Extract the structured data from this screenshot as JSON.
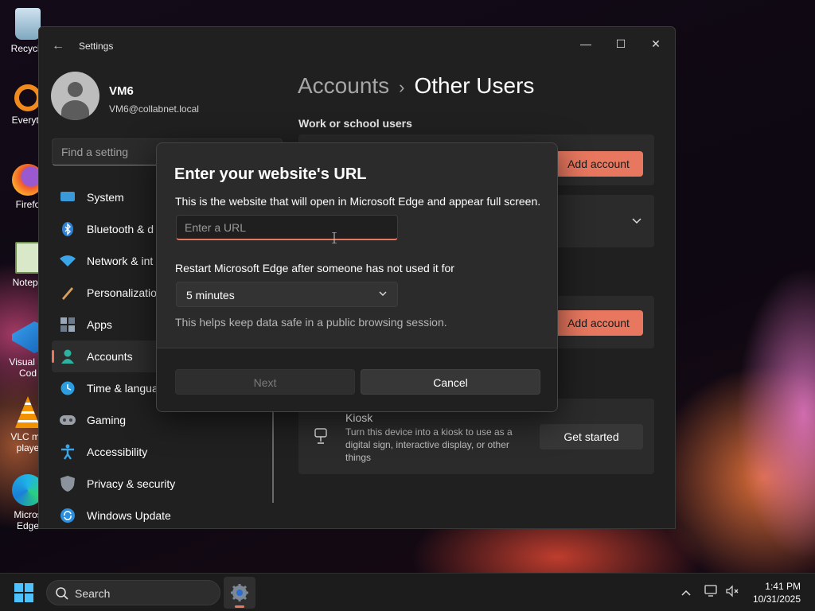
{
  "colors": {
    "accent": "#e8775f",
    "window_bg": "#202020",
    "card_bg": "#2b2b2b",
    "taskbar_bg": "#1c1c1c"
  },
  "desktop": {
    "icons": [
      {
        "label": "Recycle",
        "icon": "recycle-bin-icon"
      },
      {
        "label": "Everyth",
        "icon": "everything-search-icon"
      },
      {
        "label": "Firefo",
        "icon": "firefox-icon"
      },
      {
        "label": "Notepa",
        "icon": "notepad-icon"
      },
      {
        "label": "Visual St Cod",
        "icon": "vscode-icon"
      },
      {
        "label": "VLC me playe",
        "icon": "vlc-icon"
      },
      {
        "label": "Micros Edge",
        "icon": "edge-icon"
      }
    ]
  },
  "window": {
    "title": "Settings",
    "controls": {
      "minimize": "—",
      "maximize": "☐",
      "close": "✕"
    }
  },
  "profile": {
    "name": "VM6",
    "email": "VM6@collabnet.local"
  },
  "search": {
    "placeholder": "Find a setting"
  },
  "nav": {
    "items": [
      {
        "label": "System",
        "icon": "system-icon"
      },
      {
        "label": "Bluetooth & d",
        "icon": "bluetooth-icon"
      },
      {
        "label": "Network & int",
        "icon": "network-icon"
      },
      {
        "label": "Personalization",
        "icon": "personalization-icon"
      },
      {
        "label": "Apps",
        "icon": "apps-icon"
      },
      {
        "label": "Accounts",
        "icon": "accounts-icon"
      },
      {
        "label": "Time & langua",
        "icon": "time-language-icon"
      },
      {
        "label": "Gaming",
        "icon": "gaming-icon"
      },
      {
        "label": "Accessibility",
        "icon": "accessibility-icon"
      },
      {
        "label": "Privacy & security",
        "icon": "privacy-shield-icon"
      },
      {
        "label": "Windows Update",
        "icon": "windows-update-icon"
      }
    ],
    "active_index": 5
  },
  "main": {
    "breadcrumb": {
      "parent": "Accounts",
      "separator": "›",
      "current": "Other Users"
    },
    "section_title": "Work or school users",
    "add_account_label": "Add account",
    "add_account_label_2": "Add account",
    "kiosk": {
      "title": "Kiosk",
      "description": "Turn this device into a kiosk to use as a digital sign, interactive display, or other things",
      "button": "Get started"
    }
  },
  "dialog": {
    "title": "Enter your website's URL",
    "description": "This is the website that will open in Microsoft Edge and appear full screen.",
    "url_placeholder": "Enter a URL",
    "url_value": "",
    "restart_label": "Restart Microsoft Edge after someone has not used it for",
    "restart_value": "5 minutes",
    "help_text": "This helps keep data safe in a public browsing session.",
    "next_label": "Next",
    "cancel_label": "Cancel"
  },
  "taskbar": {
    "search_label": "Search",
    "time": "1:41 PM",
    "date": "10/31/2025"
  }
}
